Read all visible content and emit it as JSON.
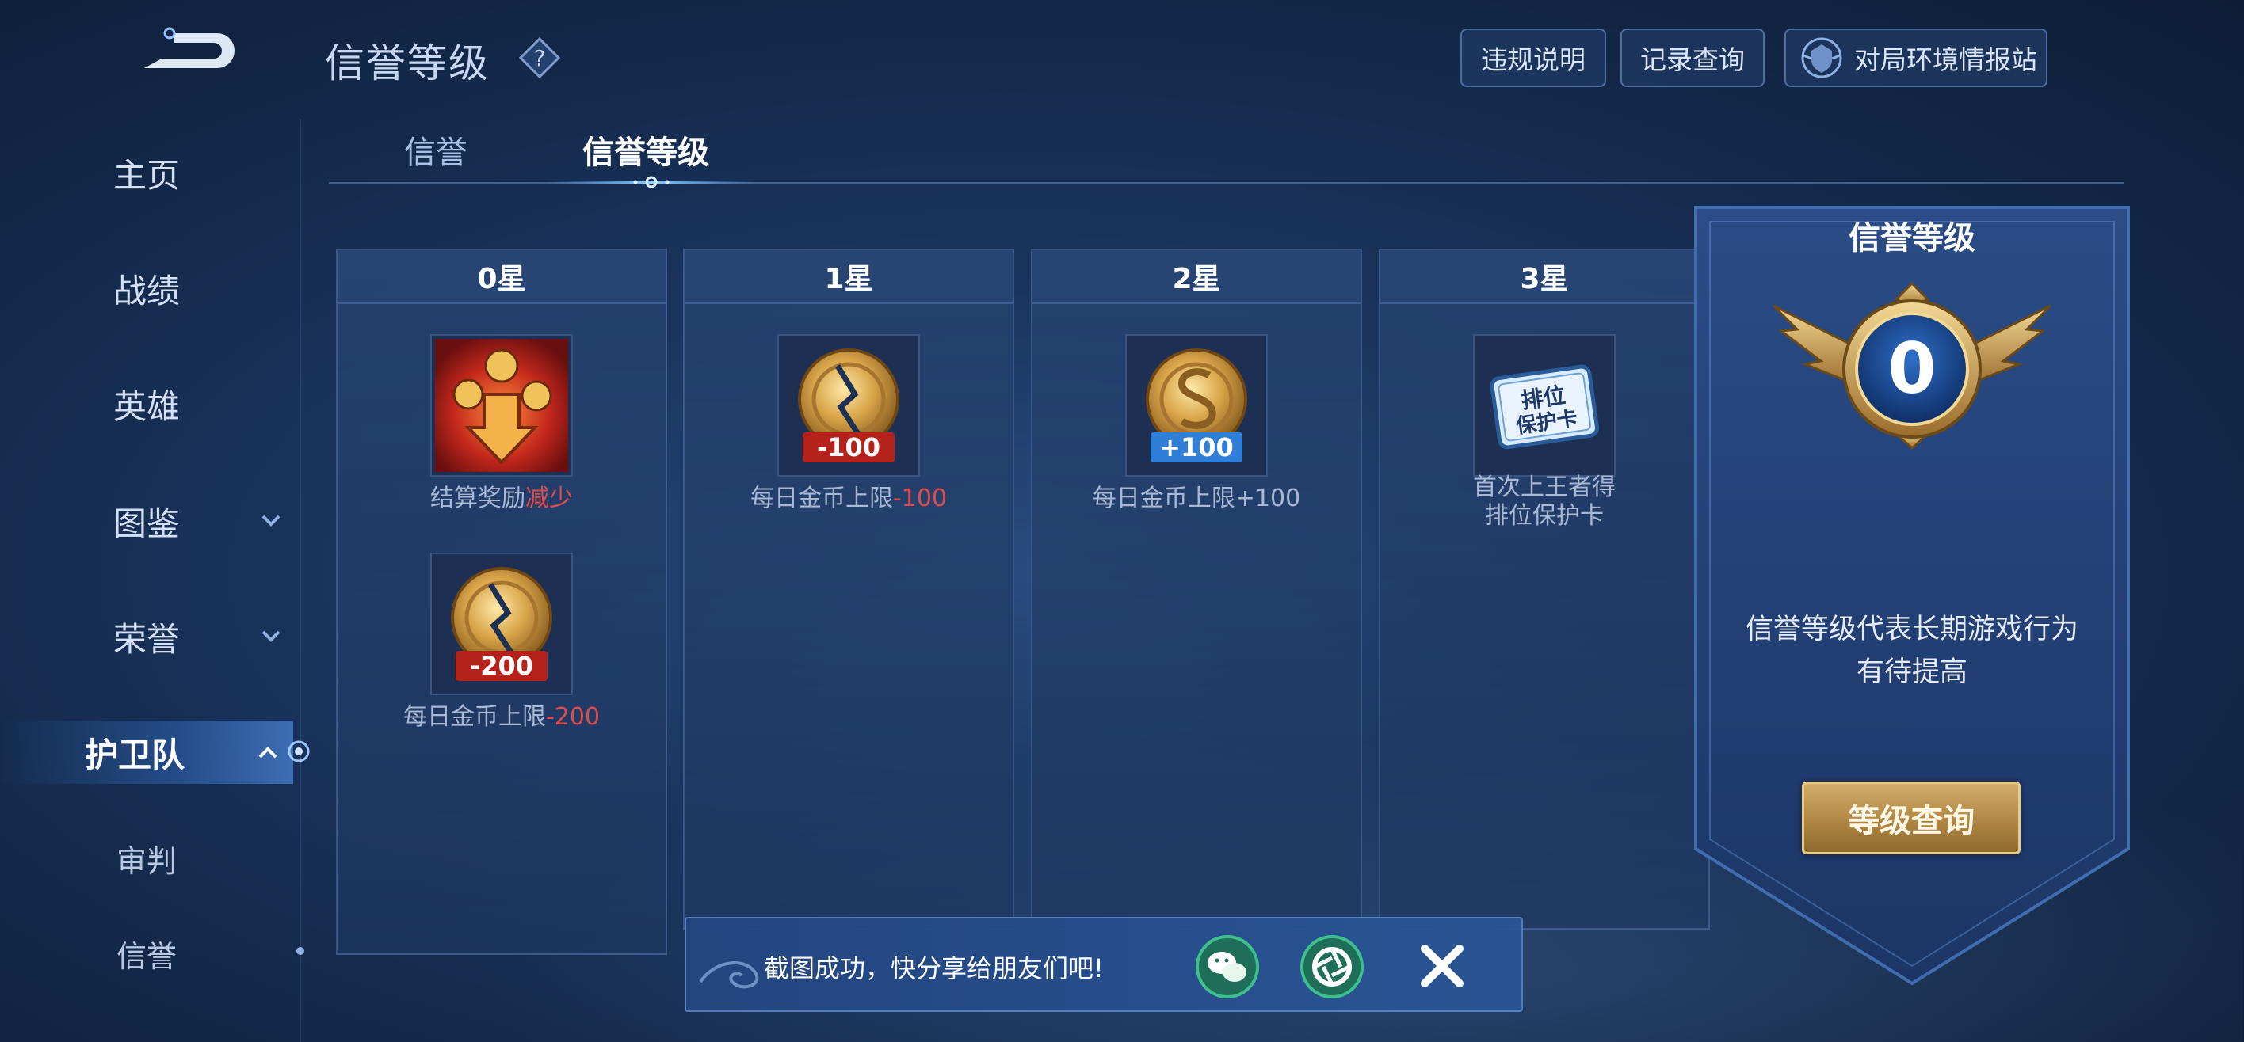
{
  "header": {
    "title": "信誉等级",
    "buttons": {
      "violation": "违规说明",
      "records": "记录查询",
      "environment": "对局环境情报站"
    }
  },
  "sidebar": {
    "items": [
      {
        "label": "主页"
      },
      {
        "label": "战绩"
      },
      {
        "label": "英雄"
      },
      {
        "label": "图鉴"
      },
      {
        "label": "荣誉"
      },
      {
        "label": "护卫队"
      },
      {
        "label": "审判"
      },
      {
        "label": "信誉"
      }
    ]
  },
  "tabs": [
    {
      "label": "信誉"
    },
    {
      "label": "信誉等级"
    }
  ],
  "columns": [
    {
      "header": "0星",
      "items": [
        {
          "icon": "settlement-reward-reduce-icon",
          "label_prefix": "结算奖励",
          "label_highlight": "减少"
        },
        {
          "icon": "coin-minus-200-icon",
          "badge": "-200",
          "label_prefix": "每日金币上限",
          "label_highlight": "-200"
        }
      ]
    },
    {
      "header": "1星",
      "items": [
        {
          "icon": "coin-minus-100-icon",
          "badge": "-100",
          "label_prefix": "每日金币上限",
          "label_highlight": "-100"
        }
      ]
    },
    {
      "header": "2星",
      "items": [
        {
          "icon": "coin-plus-100-icon",
          "badge": "+100",
          "label": "每日金币上限+100"
        }
      ]
    },
    {
      "header": "3星",
      "items": [
        {
          "icon": "rank-protection-card-icon",
          "card_text_1": "排位",
          "card_text_2": "保护卡",
          "label_line1": "首次上王者得",
          "label_line2": "排位保护卡"
        }
      ]
    }
  ],
  "rank_panel": {
    "title": "信誉等级",
    "level": "0",
    "desc_line1": "信誉等级代表长期游戏行为",
    "desc_line2": "有待提高",
    "button": "等级查询"
  },
  "toast": {
    "message": "截图成功，快分享给朋友们吧!",
    "icons": [
      "wechat-icon",
      "moments-icon",
      "close-icon"
    ]
  },
  "colors": {
    "accent_red": "#e24b4b",
    "gold": "#d3ad6a",
    "text_primary": "#ffffff",
    "text_muted": "#a9b8d3"
  }
}
